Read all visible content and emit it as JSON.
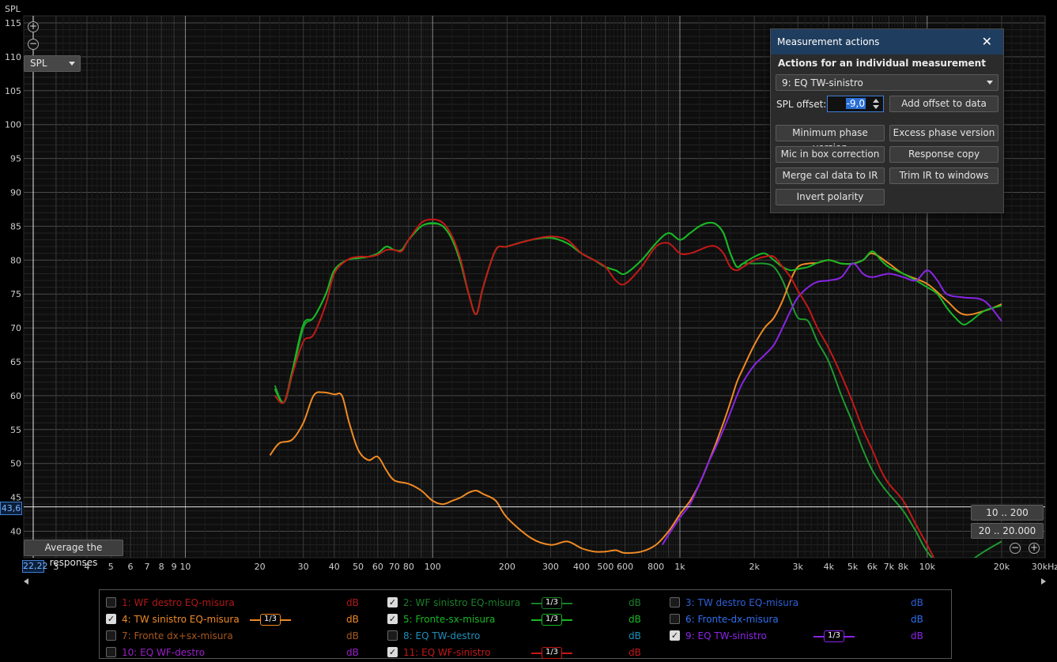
{
  "graph": {
    "y_axis_title": "SPL",
    "spl_select": "SPL",
    "y_cursor_value": "43,6",
    "x_cursor_value": "22,22",
    "average_button": "Average the responses",
    "range_btn_1": "10 .. 200",
    "range_btn_2": "20 .. 20.000",
    "y_ticks": [
      {
        "v": 115,
        "label": "115"
      },
      {
        "v": 110,
        "label": "110"
      },
      {
        "v": 105,
        "label": "105"
      },
      {
        "v": 100,
        "label": "100"
      },
      {
        "v": 95,
        "label": "95"
      },
      {
        "v": 90,
        "label": "90"
      },
      {
        "v": 85,
        "label": "85"
      },
      {
        "v": 80,
        "label": "80"
      },
      {
        "v": 75,
        "label": "75"
      },
      {
        "v": 70,
        "label": "70"
      },
      {
        "v": 65,
        "label": "65"
      },
      {
        "v": 60,
        "label": "60"
      },
      {
        "v": 55,
        "label": "55"
      },
      {
        "v": 50,
        "label": "50"
      },
      {
        "v": 45,
        "label": "45"
      },
      {
        "v": 40,
        "label": "40"
      }
    ],
    "x_ticks": [
      {
        "f": 3,
        "label": "3"
      },
      {
        "f": 4,
        "label": "4"
      },
      {
        "f": 5,
        "label": "5"
      },
      {
        "f": 6,
        "label": "6"
      },
      {
        "f": 7,
        "label": "7"
      },
      {
        "f": 8,
        "label": "8"
      },
      {
        "f": 9,
        "label": "9"
      },
      {
        "f": 10,
        "label": "10"
      },
      {
        "f": 20,
        "label": "20"
      },
      {
        "f": 30,
        "label": "30"
      },
      {
        "f": 40,
        "label": "40"
      },
      {
        "f": 50,
        "label": "50"
      },
      {
        "f": 60,
        "label": "60"
      },
      {
        "f": 70,
        "label": "70"
      },
      {
        "f": 80,
        "label": "80"
      },
      {
        "f": 100,
        "label": "100"
      },
      {
        "f": 200,
        "label": "200"
      },
      {
        "f": 300,
        "label": "300"
      },
      {
        "f": 400,
        "label": "400"
      },
      {
        "f": 500,
        "label": "500"
      },
      {
        "f": 600,
        "label": "600"
      },
      {
        "f": 800,
        "label": "800"
      },
      {
        "f": 1000,
        "label": "1k"
      },
      {
        "f": 2000,
        "label": "2k"
      },
      {
        "f": 3000,
        "label": "3k"
      },
      {
        "f": 4000,
        "label": "4k"
      },
      {
        "f": 5000,
        "label": "5k"
      },
      {
        "f": 6000,
        "label": "6k"
      },
      {
        "f": 7000,
        "label": "7k"
      },
      {
        "f": 8000,
        "label": "8k"
      },
      {
        "f": 10000,
        "label": "10k"
      },
      {
        "f": 20000,
        "label": "20k"
      },
      {
        "f": 30000,
        "label": "30kHz"
      }
    ]
  },
  "chart_data": {
    "type": "line",
    "xscale": "log",
    "xlim": [
      2.22,
      30000
    ],
    "ylim": [
      36,
      115
    ],
    "ylabel": "SPL",
    "cursor": {
      "x": 2.22,
      "y": 43.6
    },
    "series": [
      {
        "name": "2: WF sinistro EQ-misura",
        "color": "#1e9a2e",
        "x": [
          23,
          25,
          27,
          30,
          33,
          37,
          40,
          45,
          50,
          55,
          60,
          65,
          70,
          75,
          80,
          90,
          100,
          110,
          120,
          130,
          140,
          150,
          160,
          180,
          200,
          250,
          300,
          350,
          400,
          450,
          500,
          550,
          600,
          700,
          800,
          900,
          1000,
          1100,
          1200,
          1300,
          1400,
          1500,
          1600,
          1700,
          1800,
          2000,
          2200,
          2400,
          2600,
          2800,
          3000,
          3300,
          3600,
          4000,
          4500,
          5000,
          5500,
          6000,
          6500,
          7000,
          8000,
          9000,
          10000,
          12000,
          14000,
          17000,
          20000
        ],
        "y": [
          61.5,
          59.0,
          63.0,
          70.0,
          71.5,
          75.0,
          78.5,
          80.0,
          80.3,
          80.5,
          81.0,
          82.0,
          81.5,
          81.5,
          83.0,
          85.0,
          85.5,
          85.0,
          83.0,
          79.5,
          75.0,
          72.0,
          76.0,
          81.5,
          82.0,
          83.0,
          83.3,
          82.5,
          81.0,
          80.0,
          79.0,
          78.5,
          78.0,
          80.0,
          82.5,
          84.0,
          83.0,
          84.0,
          85.0,
          85.5,
          85.3,
          84.0,
          81.0,
          79.0,
          79.5,
          79.5,
          79.5,
          79.0,
          77.0,
          74.0,
          71.5,
          71.0,
          68.0,
          65.0,
          60.0,
          56.0,
          52.0,
          49.0,
          47.0,
          45.5,
          43.0,
          40.0,
          37.0,
          34.0,
          35.0,
          37.0,
          38.5
        ]
      },
      {
        "name": "4: TW sinistro EQ-misura",
        "color": "#f08a24",
        "x": [
          22,
          24,
          27,
          30,
          33,
          36,
          40,
          43,
          46,
          50,
          55,
          60,
          65,
          70,
          80,
          90,
          100,
          110,
          120,
          130,
          140,
          150,
          160,
          180,
          200,
          250,
          300,
          350,
          400,
          450,
          500,
          550,
          600,
          700,
          800,
          900,
          1000,
          1100,
          1200,
          1300,
          1400,
          1500,
          1600,
          1700,
          1800,
          2000,
          2200,
          2400,
          2600,
          2800,
          3000,
          3300,
          3600,
          4000,
          4500,
          5000,
          5500,
          6000,
          7000,
          8000,
          10000,
          12000,
          14000,
          17000,
          20000
        ],
        "y": [
          51.2,
          53.0,
          53.5,
          56.0,
          60.0,
          60.5,
          60.2,
          60.0,
          56.0,
          52.0,
          50.5,
          51.0,
          49.0,
          47.5,
          47.0,
          46.0,
          44.5,
          44.0,
          44.5,
          45.0,
          45.7,
          46.0,
          45.5,
          44.5,
          42.0,
          39.0,
          38.0,
          38.5,
          37.5,
          37.0,
          37.0,
          37.2,
          36.8,
          37.0,
          38.0,
          40.0,
          42.5,
          44.5,
          47.0,
          50.0,
          53.0,
          56.0,
          59.0,
          62.0,
          64.0,
          67.5,
          70.0,
          71.5,
          74.0,
          77.0,
          79.0,
          79.5,
          79.6,
          80.0,
          79.5,
          79.5,
          80.0,
          81.0,
          79.5,
          78.0,
          76.5,
          74.0,
          72.0,
          72.5,
          73.5
        ]
      },
      {
        "name": "5: Fronte-sx-misura",
        "color": "#18b824",
        "x": [
          23,
          25,
          27,
          30,
          33,
          37,
          40,
          45,
          50,
          55,
          60,
          65,
          70,
          75,
          80,
          90,
          100,
          110,
          120,
          130,
          140,
          150,
          160,
          180,
          200,
          250,
          300,
          350,
          400,
          450,
          500,
          550,
          600,
          700,
          800,
          900,
          1000,
          1100,
          1200,
          1300,
          1400,
          1500,
          1600,
          1700,
          1800,
          2000,
          2200,
          2400,
          2600,
          2800,
          3000,
          3300,
          3600,
          4000,
          4500,
          5000,
          5500,
          6000,
          6500,
          7000,
          8000,
          9000,
          10000,
          11000,
          12000,
          13000,
          14000,
          15000,
          17000,
          20000
        ],
        "y": [
          61.0,
          59.0,
          63.5,
          70.5,
          71.5,
          75.0,
          78.5,
          80.0,
          80.3,
          80.5,
          81.0,
          82.0,
          81.5,
          81.5,
          83.0,
          85.0,
          85.4,
          85.0,
          83.0,
          79.5,
          75.0,
          72.0,
          76.0,
          81.5,
          82.0,
          83.0,
          83.3,
          82.5,
          81.0,
          80.0,
          79.0,
          78.5,
          78.0,
          80.0,
          82.5,
          84.0,
          83.0,
          84.0,
          85.0,
          85.5,
          85.3,
          84.0,
          81.0,
          79.0,
          79.5,
          80.5,
          81.0,
          80.0,
          79.0,
          78.5,
          78.7,
          79.0,
          79.6,
          80.0,
          79.5,
          79.5,
          80.0,
          81.3,
          80.0,
          79.0,
          78.0,
          77.0,
          76.0,
          75.0,
          73.0,
          71.5,
          70.5,
          71.0,
          72.5,
          73.3
        ]
      },
      {
        "name": "9: EQ TW-sinistro",
        "color": "#8a24e6",
        "x": [
          850,
          900,
          1000,
          1100,
          1200,
          1300,
          1400,
          1500,
          1600,
          1700,
          1800,
          2000,
          2200,
          2400,
          2600,
          2800,
          3000,
          3300,
          3600,
          4000,
          4500,
          5000,
          5500,
          6000,
          7000,
          8000,
          9000,
          10000,
          11000,
          12000,
          14000,
          17000,
          20000
        ],
        "y": [
          38.0,
          39.5,
          42.0,
          44.0,
          47.0,
          50.0,
          52.5,
          55.0,
          57.5,
          60.0,
          62.0,
          64.5,
          66.0,
          67.5,
          70.0,
          72.5,
          74.5,
          76.0,
          76.8,
          77.0,
          77.5,
          79.5,
          78.0,
          77.5,
          78.0,
          77.5,
          77.0,
          78.5,
          77.0,
          75.0,
          74.5,
          74.0,
          71.0
        ]
      },
      {
        "name": "11: EQ WF-sinistro",
        "color": "#c41818",
        "x": [
          23,
          25,
          27,
          30,
          33,
          37,
          40,
          45,
          50,
          55,
          60,
          65,
          70,
          75,
          80,
          90,
          100,
          110,
          120,
          130,
          140,
          150,
          160,
          180,
          200,
          250,
          300,
          350,
          400,
          450,
          500,
          550,
          600,
          700,
          800,
          900,
          1000,
          1100,
          1200,
          1300,
          1400,
          1500,
          1600,
          1700,
          1800,
          2000,
          2200,
          2400,
          2600,
          2800,
          3000,
          3300,
          3600,
          4000,
          4500,
          5000,
          5500,
          6000,
          6500,
          7000,
          8000,
          9000,
          10000,
          11000,
          12000
        ],
        "y": [
          60.0,
          59.0,
          63.0,
          68.0,
          69.0,
          73.5,
          78.0,
          80.0,
          80.5,
          80.5,
          80.8,
          81.5,
          81.5,
          81.3,
          83.0,
          85.5,
          86.0,
          85.5,
          83.5,
          80.0,
          75.0,
          72.0,
          76.0,
          81.5,
          82.0,
          83.0,
          83.5,
          83.0,
          81.0,
          80.0,
          79.0,
          77.0,
          76.5,
          79.0,
          82.0,
          82.5,
          81.0,
          81.0,
          81.5,
          82.0,
          82.0,
          81.0,
          79.0,
          78.5,
          79.0,
          80.0,
          80.5,
          80.5,
          79.0,
          77.5,
          75.5,
          73.0,
          70.0,
          67.0,
          63.0,
          59.0,
          55.0,
          52.0,
          49.0,
          47.0,
          44.5,
          41.0,
          38.0,
          35.0,
          32.0
        ]
      }
    ]
  },
  "panel": {
    "title": "Measurement actions",
    "subtitle": "Actions for an individual measurement",
    "selected_measurement": "9: EQ TW-sinistro",
    "offset_label": "SPL offset:",
    "offset_value": "-9,0",
    "add_offset": "Add offset to data",
    "min_phase": "Minimum phase version",
    "excess_phase": "Excess phase version",
    "mic_in_box": "Mic in box correction",
    "response_copy": "Response copy",
    "merge_cal": "Merge cal data to IR",
    "trim_ir": "Trim IR to windows",
    "invert_polarity": "Invert polarity"
  },
  "legend": {
    "smooth_label": "1/3",
    "items": [
      {
        "id": "m1",
        "label": "1: WF destro EQ-misura",
        "color": "#b21818",
        "checked": false,
        "smoothing": false,
        "unit": "dB"
      },
      {
        "id": "m2",
        "label": "2: WF sinistro EQ-misura",
        "color": "#1a7f2a",
        "checked": true,
        "smoothing": true,
        "unit": "dB"
      },
      {
        "id": "m3",
        "label": "3: TW destro EQ-misura",
        "color": "#2f5fd8",
        "checked": false,
        "smoothing": false,
        "unit": "dB"
      },
      {
        "id": "m4",
        "label": "4: TW sinistro EQ-misura",
        "color": "#f08a24",
        "checked": true,
        "smoothing": true,
        "unit": "dB"
      },
      {
        "id": "m5",
        "label": "5: Fronte-sx-misura",
        "color": "#18b824",
        "checked": true,
        "smoothing": true,
        "unit": "dB"
      },
      {
        "id": "m6",
        "label": "6: Fronte-dx-misura",
        "color": "#2f6ff0",
        "checked": false,
        "smoothing": false,
        "unit": "dB"
      },
      {
        "id": "m7",
        "label": "7: Fronte dx+sx-misura",
        "color": "#a8581c",
        "checked": false,
        "smoothing": false,
        "unit": "dB"
      },
      {
        "id": "m8",
        "label": "8: EQ TW-destro",
        "color": "#1e8fb8",
        "checked": false,
        "smoothing": false,
        "unit": "dB"
      },
      {
        "id": "m9",
        "label": "9: EQ TW-sinistro",
        "color": "#8a24e6",
        "checked": true,
        "smoothing": true,
        "unit": "dB"
      },
      {
        "id": "m10",
        "label": "10: EQ WF-destro",
        "color": "#9a1ec8",
        "checked": false,
        "smoothing": false,
        "unit": "dB"
      },
      {
        "id": "m11",
        "label": "11: EQ WF-sinistro",
        "color": "#c41818",
        "checked": true,
        "smoothing": true,
        "unit": "dB"
      }
    ]
  }
}
